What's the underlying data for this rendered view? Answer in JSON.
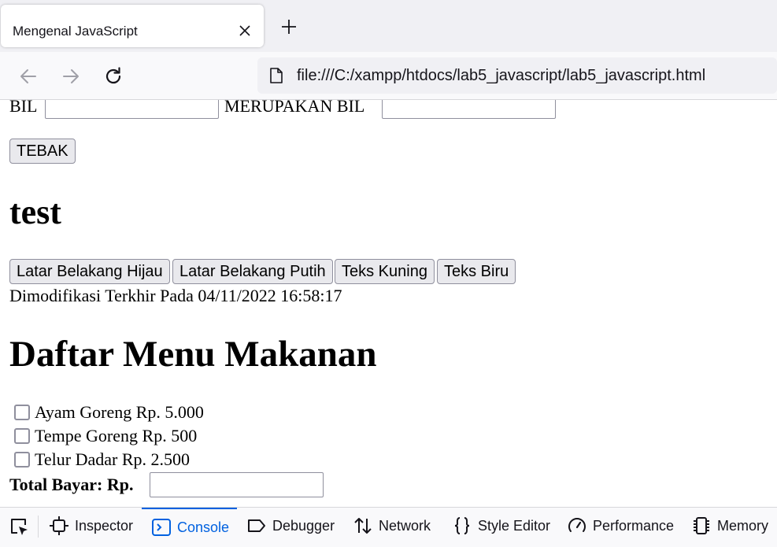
{
  "browser": {
    "tab_title": "Mengenal JavaScript",
    "url": "file:///C:/xampp/htdocs/lab5_javascript/lab5_javascript.html"
  },
  "form": {
    "bil_label": "BIL",
    "bil_value": "",
    "merupakan_label": "MERUPAKAN BIL",
    "merupakan_value": "",
    "tebak_label": "TEBAK"
  },
  "heading_test": "test",
  "color_buttons": {
    "hijau": "Latar Belakang Hijau",
    "putih": "Latar Belakang Putih",
    "kuning": "Teks Kuning",
    "biru": "Teks Biru"
  },
  "modified_text": "Dimodifikasi Terkhir Pada 04/11/2022 16:58:17",
  "menu": {
    "title": "Daftar Menu Makanan",
    "items": [
      {
        "label": "Ayam Goreng Rp. 5.000",
        "checked": false
      },
      {
        "label": "Tempe Goreng Rp. 500",
        "checked": false
      },
      {
        "label": "Telur Dadar Rp. 2.500",
        "checked": false
      }
    ],
    "total_label": "Total Bayar: Rp.",
    "total_value": ""
  },
  "devtools": {
    "tabs": [
      {
        "label": "Inspector",
        "icon": "inspector-icon"
      },
      {
        "label": "Console",
        "icon": "console-icon",
        "active": true
      },
      {
        "label": "Debugger",
        "icon": "debugger-icon"
      },
      {
        "label": "Network",
        "icon": "network-icon"
      },
      {
        "label": "Style Editor",
        "icon": "style-editor-icon"
      },
      {
        "label": "Performance",
        "icon": "performance-icon"
      },
      {
        "label": "Memory",
        "icon": "memory-icon"
      }
    ]
  },
  "colors": {
    "accent": "#0061e0",
    "tabstrip": "#f0f0f4",
    "button_bg": "#e9e9ed"
  }
}
